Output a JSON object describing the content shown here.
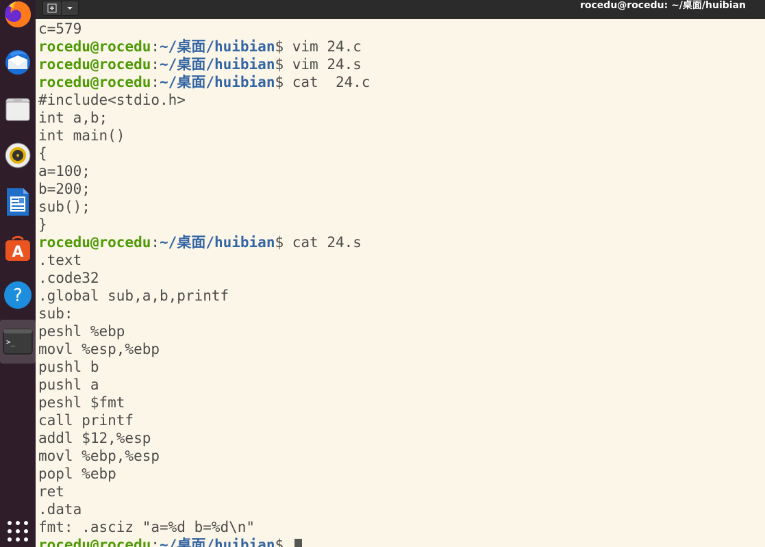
{
  "window": {
    "title": "rocedu@rocedu: ~/桌面/huibian"
  },
  "titlebar": {
    "new_tab_icon": "new-tab-icon",
    "menu_icon": "chevron-down-icon"
  },
  "dock": {
    "items": [
      {
        "name": "Firefox",
        "icon": "firefox-icon"
      },
      {
        "name": "Thunderbird",
        "icon": "mail-icon"
      },
      {
        "name": "Files",
        "icon": "folder-icon"
      },
      {
        "name": "Rhythmbox",
        "icon": "music-icon"
      },
      {
        "name": "LibreOffice Writer",
        "icon": "document-icon"
      },
      {
        "name": "Ubuntu Software",
        "icon": "software-icon"
      },
      {
        "name": "Help",
        "icon": "help-icon"
      },
      {
        "name": "Terminal",
        "icon": "terminal-icon"
      },
      {
        "name": "Show Applications",
        "icon": "app-grid-icon"
      }
    ],
    "terminal_glyph": ">_"
  },
  "colors": {
    "background": "#fbf6e7",
    "text": "#4b4b4b",
    "prompt_user": "#4e9a06",
    "prompt_path": "#3465a4"
  },
  "terminal": {
    "prompt": {
      "user": "rocedu@rocedu",
      "colon": ":",
      "path": "~/桌面/huibian",
      "symbol": "$ "
    },
    "lines": [
      {
        "type": "out",
        "text": "c=579"
      },
      {
        "type": "cmd",
        "text": "vim 24.c"
      },
      {
        "type": "cmd",
        "text": "vim 24.s"
      },
      {
        "type": "cmd",
        "text": "cat  24.c"
      },
      {
        "type": "out",
        "text": "#include<stdio.h>"
      },
      {
        "type": "out",
        "text": "int a,b;"
      },
      {
        "type": "out",
        "text": "int main()"
      },
      {
        "type": "out",
        "text": "{"
      },
      {
        "type": "out",
        "text": "a=100;"
      },
      {
        "type": "out",
        "text": "b=200;"
      },
      {
        "type": "out",
        "text": "sub();"
      },
      {
        "type": "out",
        "text": "}"
      },
      {
        "type": "cmd",
        "text": "cat 24.s"
      },
      {
        "type": "out",
        "text": ".text"
      },
      {
        "type": "out",
        "text": ".code32"
      },
      {
        "type": "out",
        "text": ".global sub,a,b,printf"
      },
      {
        "type": "out",
        "text": "sub:"
      },
      {
        "type": "out",
        "text": "peshl %ebp"
      },
      {
        "type": "out",
        "text": "movl %esp,%ebp"
      },
      {
        "type": "out",
        "text": "pushl b"
      },
      {
        "type": "out",
        "text": "pushl a"
      },
      {
        "type": "out",
        "text": "peshl $fmt"
      },
      {
        "type": "out",
        "text": "call printf"
      },
      {
        "type": "out",
        "text": "addl $12,%esp"
      },
      {
        "type": "out",
        "text": "movl %ebp,%esp"
      },
      {
        "type": "out",
        "text": "popl %ebp"
      },
      {
        "type": "out",
        "text": "ret"
      },
      {
        "type": "out",
        "text": ".data"
      },
      {
        "type": "out",
        "text": "fmt: .asciz \"a=%d b=%d\\n\""
      },
      {
        "type": "cmd",
        "text": "",
        "cursor": true
      }
    ]
  }
}
